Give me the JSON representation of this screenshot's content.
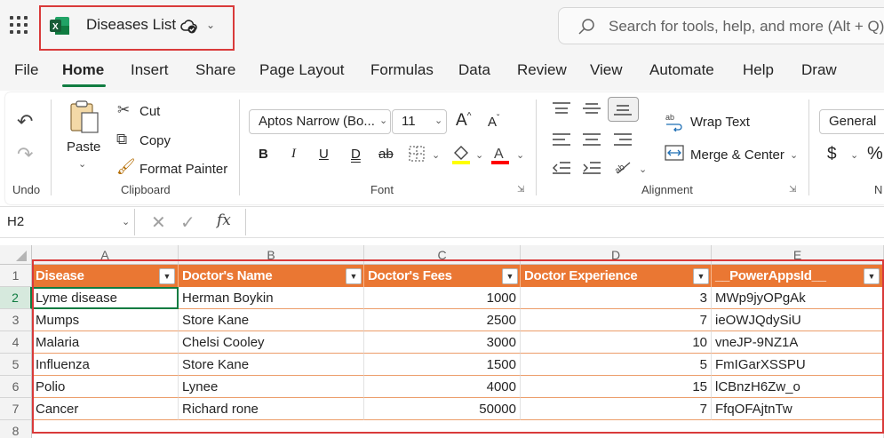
{
  "app": {
    "doc_title": "Diseases List",
    "search_placeholder": "Search for tools, help, and more (Alt + Q)",
    "brand_color": "#107c41",
    "icons": [
      "waffle-icon",
      "excel-logo-icon",
      "saved-status-icon",
      "chevron-down-icon",
      "search-icon"
    ]
  },
  "menu": {
    "tabs": [
      "File",
      "Home",
      "Insert",
      "Share",
      "Page Layout",
      "Formulas",
      "Data",
      "Review",
      "View",
      "Automate",
      "Help",
      "Draw"
    ],
    "active": "Home"
  },
  "ribbon": {
    "undo_group": "Undo",
    "clipboard": {
      "paste": "Paste",
      "cut": "Cut",
      "copy": "Copy",
      "format_painter": "Format Painter",
      "group": "Clipboard"
    },
    "font": {
      "family": "Aptos Narrow (Bo...",
      "size": "11",
      "bold": "B",
      "italic": "I",
      "underline": "U",
      "double_underline": "D",
      "strike": "ab",
      "grow": "A",
      "shrink": "A",
      "group": "Font",
      "fill_color": "#ffff00",
      "font_color": "#ff0000"
    },
    "alignment": {
      "wrap": "Wrap Text",
      "merge": "Merge & Center",
      "group": "Alignment"
    },
    "number": {
      "format": "General",
      "currency": "$",
      "percent": "%",
      "group": "N"
    }
  },
  "formula_bar": {
    "name_box": "H2",
    "fx": "fx",
    "value": ""
  },
  "sheet": {
    "columns": [
      "A",
      "B",
      "C",
      "D",
      "E"
    ],
    "rows": [
      "1",
      "2",
      "3",
      "4",
      "5",
      "6",
      "7",
      "8"
    ],
    "header_fill": "#ea7733",
    "headers": [
      "Disease",
      "Doctor's Name",
      "Doctor's Fees",
      "Doctor Experience",
      "__PowerAppsId__"
    ],
    "data": [
      [
        "Lyme disease",
        "Herman Boykin",
        "1000",
        "3",
        "MWp9jyOPgAk"
      ],
      [
        "Mumps",
        "Store Kane",
        "2500",
        "7",
        "ieOWJQdySiU"
      ],
      [
        "Malaria",
        "Chelsi Cooley",
        "3000",
        "10",
        "vneJP-9NZ1A"
      ],
      [
        "Influenza",
        "Store Kane",
        "1500",
        "5",
        "FmIGarXSSPU"
      ],
      [
        "Polio",
        "Lynee",
        "4000",
        "15",
        "lCBnzH6Zw_o"
      ],
      [
        "Cancer",
        "Richard rone",
        "50000",
        "7",
        "FfqOFAjtnTw"
      ]
    ]
  }
}
